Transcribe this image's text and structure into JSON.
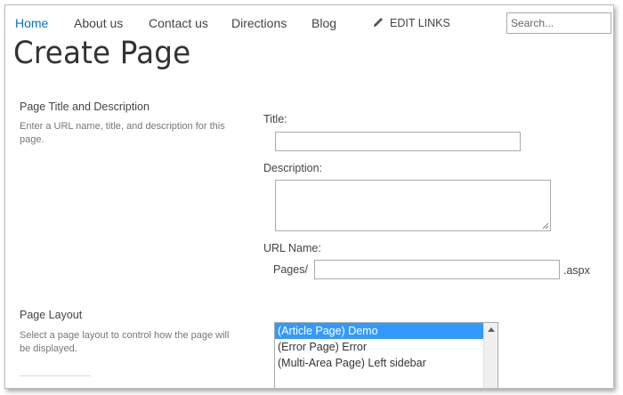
{
  "nav": {
    "items": [
      {
        "label": "Home",
        "active": true
      },
      {
        "label": "About us"
      },
      {
        "label": "Contact us"
      },
      {
        "label": "Directions"
      },
      {
        "label": "Blog"
      }
    ],
    "edit_links": "EDIT LINKS",
    "search_placeholder": "Search..."
  },
  "page_title": "Create Page",
  "title_section": {
    "heading": "Page Title and Description",
    "description": "Enter a URL name, title, and description for this page.",
    "title_label": "Title:",
    "title_value": "",
    "description_label": "Description:",
    "description_value": "",
    "url_label": "URL Name:",
    "url_prefix": "Pages/",
    "url_value": "",
    "url_suffix": ".aspx"
  },
  "layout_section": {
    "heading": "Page Layout",
    "description": "Select a page layout to control how the page will be displayed.",
    "options": [
      {
        "label": "(Article Page) Demo",
        "selected": true
      },
      {
        "label": "(Error Page) Error"
      },
      {
        "label": "(Multi-Area Page) Left sidebar"
      }
    ]
  },
  "colors": {
    "accent": "#0072c6",
    "selection": "#3399ff"
  }
}
